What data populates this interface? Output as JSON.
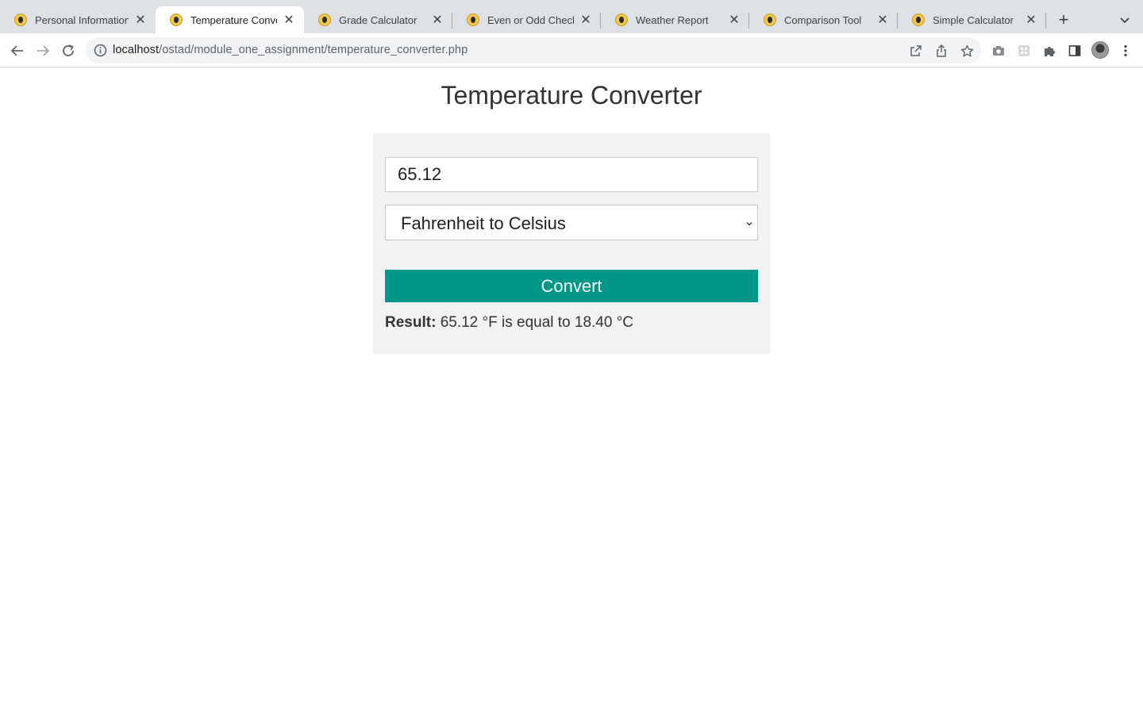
{
  "browser": {
    "tabs": [
      {
        "label": "Personal Information F",
        "active": false
      },
      {
        "label": "Temperature Convert",
        "active": true
      },
      {
        "label": "Grade Calculator",
        "active": false
      },
      {
        "label": "Even or Odd Checker",
        "active": false
      },
      {
        "label": "Weather Report",
        "active": false
      },
      {
        "label": "Comparison Tool",
        "active": false
      },
      {
        "label": "Simple Calculator",
        "active": false
      }
    ],
    "new_tab_symbol": "+",
    "url_host": "localhost",
    "url_path": "/ostad/module_one_assignment/temperature_converter.php"
  },
  "page": {
    "title": "Temperature Converter",
    "form": {
      "temperature_value": "65.12",
      "conversion_selected": "Fahrenheit to Celsius",
      "convert_label": "Convert"
    },
    "result": {
      "label": "Result:",
      "text": "65.12 °F is equal to 18.40 °C"
    }
  },
  "colors": {
    "accent": "#009688",
    "card_bg": "#f2f2f2",
    "tabstrip_bg": "#dee1e6",
    "favicon": "#f2c94c"
  }
}
